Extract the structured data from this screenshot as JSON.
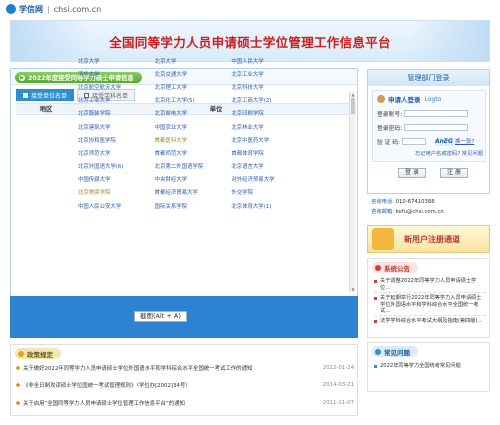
{
  "topbar": {
    "brand": "学信网",
    "domain": "chsi.com.cn"
  },
  "banner": {
    "title": "全国同等学力人员申请硕士学位管理工作信息平台"
  },
  "main": {
    "section_title": "2022年度接受同等学力硕士申请信息",
    "tabs": [
      {
        "label": "接受单位名单"
      },
      {
        "label": "接受学科名单"
      }
    ],
    "columns": [
      "地区",
      "单位"
    ],
    "universities": [
      [
        "北京大学",
        "北京大学",
        "中国人民大学"
      ],
      [
        "清华大学",
        "北京交通大学",
        "北京工业大学"
      ],
      [
        "北京航空航天大学",
        "北京理工大学",
        "北京科技大学"
      ],
      [
        "北方工业大学",
        "北京化工大学(5)",
        "北京工商大学(2)"
      ],
      [
        "北京服装学院",
        "北京邮电大学",
        "北京印刷学院"
      ],
      [
        "北京建筑大学",
        "中国农业大学",
        "北京林业大学"
      ],
      [
        "北京协和医学院",
        "首都医科大学",
        "北京中医药大学"
      ],
      [
        "北京师范大学",
        "首都师范大学",
        "首都体育学院"
      ],
      [
        "北京外国语大学(6)",
        "北京第二外国语学院",
        "北京语言大学"
      ],
      [
        "中国传媒大学",
        "中央财经大学",
        "对外经济贸易大学"
      ],
      [
        "北京物资学院",
        "首都经济贸易大学",
        "外交学院"
      ],
      [
        "中国人民公安大学",
        "国际关系学院",
        "北京体育大学(1)"
      ]
    ],
    "highlighted": [
      "首都医科大学",
      "北京物资学院"
    ],
    "screenshot_badge": "截图(Alt + A)"
  },
  "policies": {
    "title": "政策规定",
    "items": [
      {
        "text": "关于做好2022年同等学力人员申请硕士学位外国语水平和学科综合水平全国统一考试工作的通知",
        "date": "2022-01-24"
      },
      {
        "text": "《非全日制攻读硕士学位国统一考试管理规则》（学位办[2002]34号）",
        "date": "2014-03-21"
      },
      {
        "text": "关于启用“全国同等学力人员申请硕士学位管理工作信息平台”的通知",
        "date": "2011-11-07"
      }
    ]
  },
  "login": {
    "header": "管理部门登录",
    "title": "申请人登录",
    "logto": "Logto",
    "fields": {
      "username": "登录账号:",
      "password": "登录密码:",
      "captcha": "验 证 码:"
    },
    "captcha_text": "AnEG",
    "swap": "换一张?",
    "forgot": "忘记用户名或密码?  常见问题",
    "login_btn": "登 录",
    "register_btn": "注 册",
    "phone_label": "咨询电话:",
    "phone": "010-67410388",
    "email_label": "咨询邮箱:",
    "email": "kefu@chsi.com.cn"
  },
  "newuser": {
    "label": "新用户注册通道"
  },
  "notice": {
    "title": "系统公告",
    "items": [
      "关于调整2022年同等学力人员申请硕士学位...",
      "关于延期举行2022年同等学力人员申请硕士学位外国语水平和学科综合水平全国统一考试...",
      "法学学科综合水平考试大纲及指南(第四版)..."
    ]
  },
  "faq": {
    "title": "常见问题",
    "items": [
      "2022年同等学力全国统考常见问题"
    ]
  }
}
